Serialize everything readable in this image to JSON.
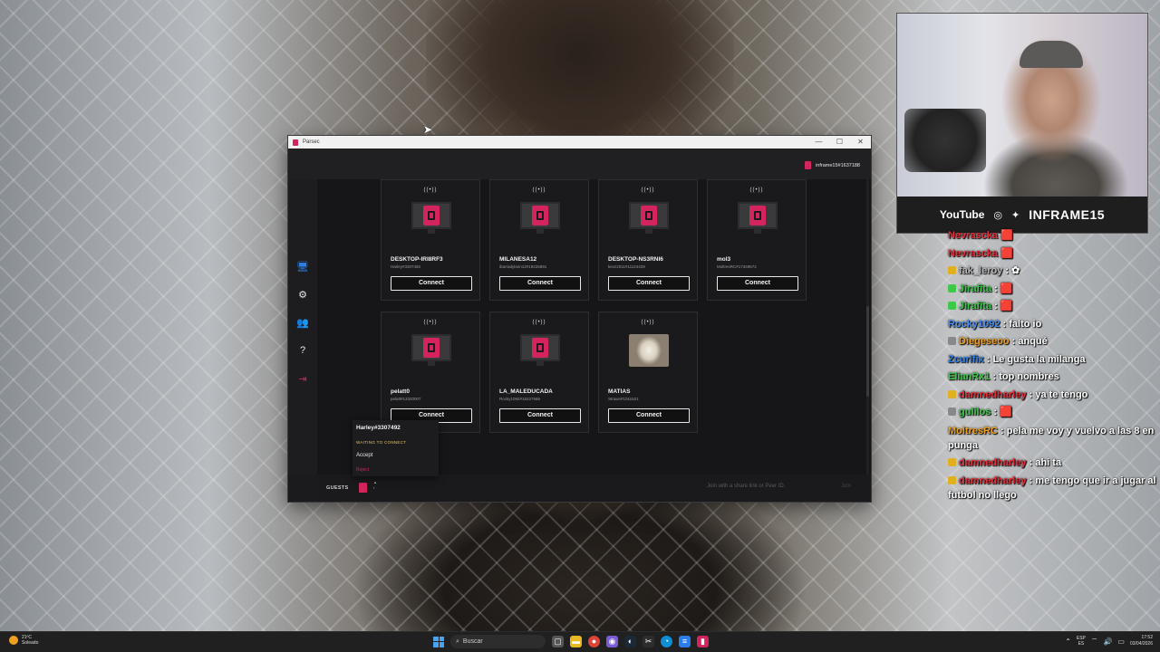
{
  "parsec": {
    "window_title": "Parsec",
    "user": "inframe15#1637188",
    "sidebar": {
      "computers_icon": "computer-icon",
      "settings_icon": "gear-icon",
      "friends_icon": "friends-icon",
      "help_icon": "help-icon",
      "logout_icon": "logout-icon"
    },
    "computers": [
      {
        "name": "DESKTOP-IRI8RF3",
        "peer": "Harley#3307492",
        "button": "Connect"
      },
      {
        "name": "MILANESA12",
        "peer": "ibarradylann12#19226891",
        "button": "Connect"
      },
      {
        "name": "DESKTOP-NS3RNI6",
        "peer": "kevz2011#11124429",
        "button": "Connect"
      },
      {
        "name": "mol3",
        "peer": "MoltresRC#17349672",
        "button": "Connect"
      },
      {
        "name": "pelatt0",
        "peer": "pelatt#13320007",
        "button": "Connect"
      },
      {
        "name": "LA_MALEDUCADA",
        "peer": "Rocky1092#19227686",
        "button": "Connect"
      },
      {
        "name": "MATIAS",
        "peer": "Strawn#1011521",
        "button": "Connect"
      }
    ],
    "guest_popup": {
      "user": "Harley#3307492",
      "status": "WAITING TO CONNECT",
      "accept": "Accept",
      "reject": "Reject"
    },
    "bottom": {
      "guests_label": "GUESTS",
      "join_placeholder": "Join with a share link or Peer ID.",
      "join_button": "Join"
    }
  },
  "stream_overlay": {
    "youtube": "YouTube",
    "handle": "INFRAME15"
  },
  "chat": [
    {
      "user": "Nevrascka",
      "msg": "",
      "color": "#e0303a"
    },
    {
      "user": "Nevrascka",
      "msg": "",
      "color": "#e0303a"
    },
    {
      "user": "fak_leroy",
      "msg": "",
      "color": "#b8b8b8"
    },
    {
      "user": "Jirafita",
      "msg": "",
      "color": "#3ec84a"
    },
    {
      "user": "Jirafita",
      "msg": "",
      "color": "#3ec84a"
    },
    {
      "user": "Rocky1092",
      "msg": "falto io",
      "color": "#4a8ff0"
    },
    {
      "user": "Diegeseoo",
      "msg": "anqué",
      "color": "#f0a020"
    },
    {
      "user": "Zcurlfix",
      "msg": "Le gusta la milanga",
      "color": "#2f7de1"
    },
    {
      "user": "ElianRx1",
      "msg": "top nombres",
      "color": "#3ec84a"
    },
    {
      "user": "damnedharley",
      "msg": "ya te tengo",
      "color": "#e0303a"
    },
    {
      "user": "gulilos",
      "msg": "",
      "color": "#3ec84a"
    },
    {
      "user": "MoltresRC",
      "msg": "pela me voy y vuelvo a las 8 en punga",
      "color": "#f0a020"
    },
    {
      "user": "damnedharley",
      "msg": "ahi ta",
      "color": "#e0303a"
    },
    {
      "user": "damnedharley",
      "msg": "me tengo que ir a jugar al futbol no llego",
      "color": "#e0303a"
    }
  ],
  "taskbar": {
    "weather_temp": "21ºC",
    "weather_desc": "Soleado",
    "search_placeholder": "Buscar",
    "lang_line1": "ESP",
    "lang_line2": "ES",
    "time": "17:52",
    "date": "03/04/2026"
  }
}
